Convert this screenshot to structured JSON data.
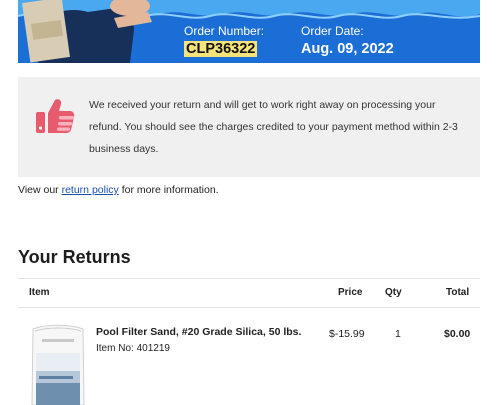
{
  "header": {
    "order_number_label": "Order Number:",
    "order_number": "CLP36322",
    "order_date_label": "Order Date:",
    "order_date": "Aug. 09, 2022"
  },
  "notice": {
    "icon": "thumbs-up-icon",
    "text": "We received your return and will get to work right away on processing your refund. You should see the charges credited to your payment method within 2-3 business days."
  },
  "policy": {
    "prefix": "View our",
    "link": "return policy",
    "suffix": "for more information."
  },
  "returns": {
    "title": "Your Returns",
    "columns": {
      "item": "Item",
      "price": "Price",
      "qty": "Qty",
      "total": "Total"
    },
    "items": [
      {
        "name": "Pool Filter Sand, #20 Grade Silica, 50 lbs.",
        "item_no": "Item No: 401219",
        "price": "$-15.99",
        "qty": "1",
        "total": "$0.00"
      }
    ]
  },
  "colors": {
    "banner": "#1b6ed6",
    "highlight": "#f6e27a",
    "thumb": "#e85a6e",
    "notice_bg": "#f0f0f0",
    "link": "#1a4fb0"
  }
}
